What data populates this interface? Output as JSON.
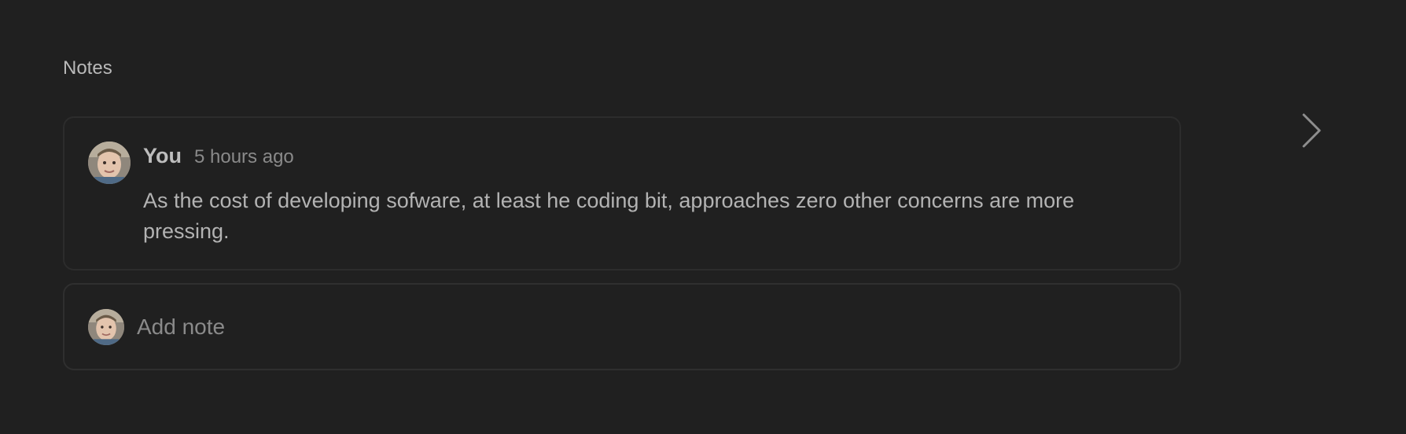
{
  "section": {
    "title": "Notes"
  },
  "note": {
    "author": "You",
    "time": "5 hours ago",
    "body": "As the cost of developing sofware, at least he coding bit, approaches zero other concerns are more pressing.",
    "avatar_icon": "user-avatar-photo"
  },
  "add_note": {
    "placeholder": "Add note",
    "avatar_icon": "user-avatar-photo"
  },
  "nav": {
    "next_icon": "chevron-right-icon"
  },
  "colors": {
    "background": "#202020",
    "card_border": "#2c2c2c",
    "text_primary": "#bdbdbd",
    "text_muted": "#8a8a8a"
  }
}
